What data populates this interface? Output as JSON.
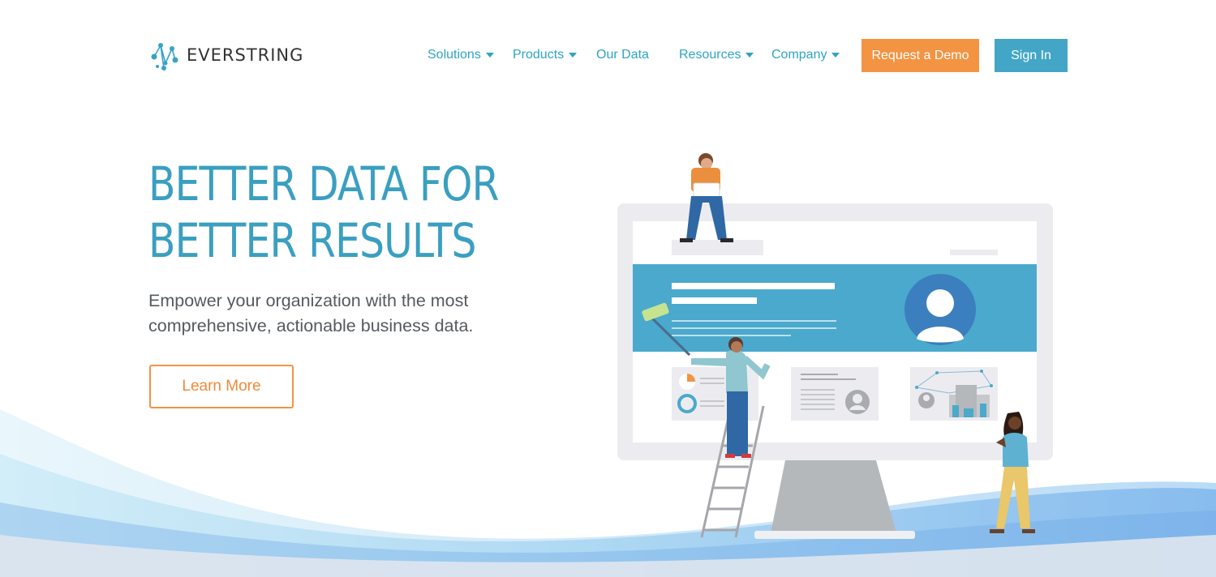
{
  "brand": {
    "name": "EVERSTRING"
  },
  "nav": {
    "items": [
      {
        "label": "Solutions",
        "dropdown": true
      },
      {
        "label": "Products",
        "dropdown": true
      },
      {
        "label": "Our Data",
        "dropdown": false
      },
      {
        "label": "Resources",
        "dropdown": true
      },
      {
        "label": "Company",
        "dropdown": true
      }
    ],
    "demo_label": "Request a Demo",
    "signin_label": "Sign In"
  },
  "hero": {
    "headline_line1": "BETTER DATA FOR",
    "headline_line2": "BETTER RESULTS",
    "subtitle": "Empower your organization with the most comprehensive, actionable business data.",
    "cta_label": "Learn More"
  },
  "colors": {
    "accent_blue": "#43a6c6",
    "accent_orange": "#f39443",
    "headline": "#3a9fc0",
    "body_text": "#555a60"
  },
  "icons": {
    "logo": "network-nodes-icon",
    "dropdown": "caret-down-icon",
    "avatar": "user-avatar-icon"
  }
}
